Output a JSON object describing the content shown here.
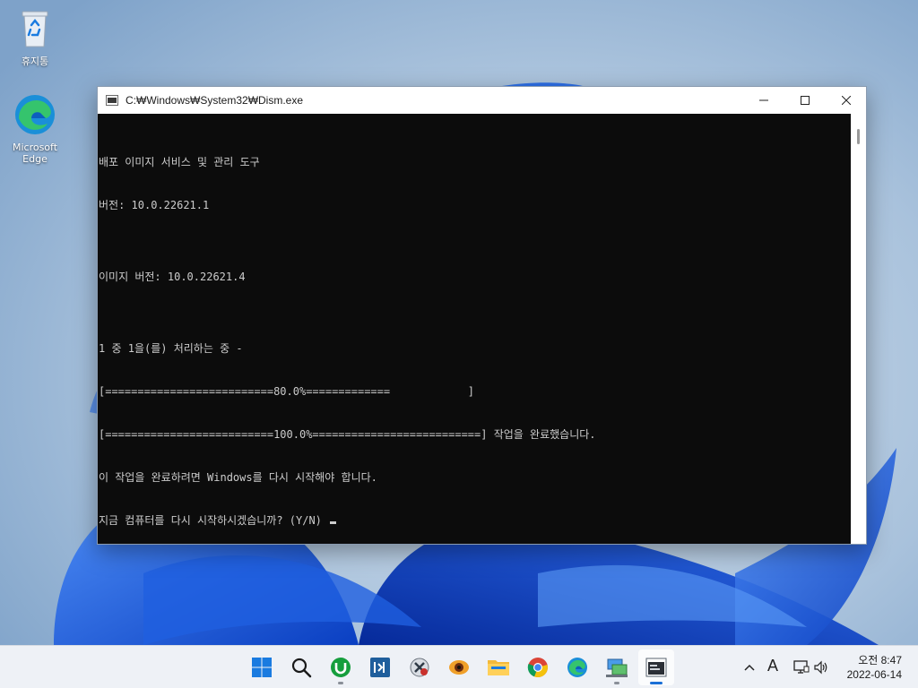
{
  "desktop": {
    "icons": [
      {
        "label": "휴지통",
        "icon": "recycle-bin-icon"
      },
      {
        "label": "Microsoft\nEdge",
        "icon": "edge-icon"
      }
    ]
  },
  "window": {
    "title": "C:₩Windows₩System32₩Dism.exe",
    "controls": {
      "minimize": "minimize-icon",
      "maximize": "maximize-icon",
      "close": "close-icon"
    },
    "console_lines": [
      "배포 이미지 서비스 및 관리 도구",
      "버전: 10.0.22621.1",
      "",
      "이미지 버전: 10.0.22621.4",
      "",
      "1 중 1을(를) 처리하는 중 -",
      "[==========================80.0%=============            ]",
      "[==========================100.0%==========================] 작업을 완료했습니다.",
      "이 작업을 완료하려면 Windows를 다시 시작해야 합니다.",
      "지금 컴퓨터를 다시 시작하시겠습니까? (Y/N) "
    ],
    "progress_first": 80.0,
    "progress_second": 100.0
  },
  "taskbar": {
    "apps": [
      {
        "name": "start-button",
        "icon": "windows-logo-icon"
      },
      {
        "name": "search-button",
        "icon": "search-icon"
      },
      {
        "name": "taskbar-utorrent",
        "icon": "utorrent-icon"
      },
      {
        "name": "taskbar-app-blue",
        "icon": "app-tile-icon"
      },
      {
        "name": "taskbar-tool",
        "icon": "tools-icon"
      },
      {
        "name": "taskbar-viewer",
        "icon": "eye-icon"
      },
      {
        "name": "taskbar-file-explorer",
        "icon": "folder-icon"
      },
      {
        "name": "taskbar-chrome",
        "icon": "chrome-icon"
      },
      {
        "name": "taskbar-edge",
        "icon": "edge-icon"
      },
      {
        "name": "taskbar-network",
        "icon": "network-icon"
      },
      {
        "name": "taskbar-console",
        "icon": "console-icon"
      }
    ],
    "tray": {
      "input_indicator": "A",
      "clock_time": "오전 8:47",
      "clock_date": "2022-06-14"
    }
  },
  "colors": {
    "console_bg": "#0c0c0c",
    "console_fg": "#cccccc",
    "accent": "#1a6fd6"
  }
}
